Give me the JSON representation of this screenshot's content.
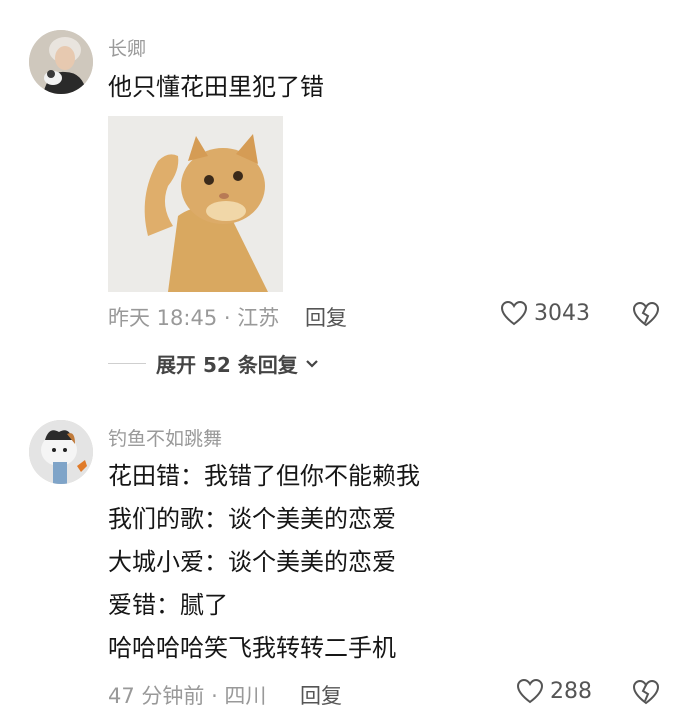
{
  "comments": [
    {
      "username": "长卿",
      "text_lines": [
        "他只懂花田里犯了错"
      ],
      "meta": "昨天 18:45 · 江苏",
      "reply_label": "回复",
      "likes": "3043",
      "expand_label": "展开 52 条回复"
    },
    {
      "username": "钓鱼不如跳舞",
      "text_lines": [
        "花田错：我错了但你不能赖我",
        "我们的歌：谈个美美的恋爱",
        "大城小爱：谈个美美的恋爱",
        "爱错：腻了",
        "哈哈哈哈笑飞我转转二手机"
      ],
      "meta": "47 分钟前 · 四川",
      "reply_label": "回复",
      "likes": "288"
    }
  ]
}
